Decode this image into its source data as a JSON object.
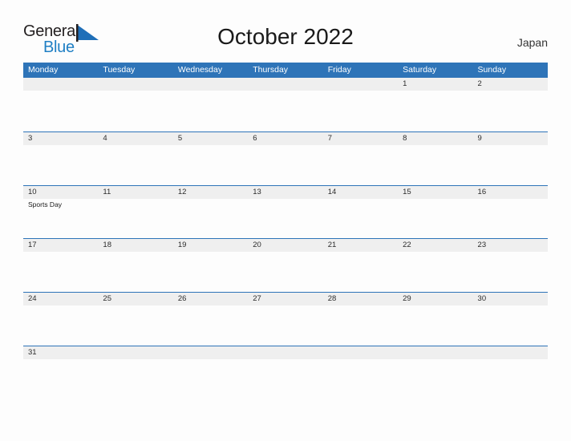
{
  "brand": {
    "word_one": "General",
    "word_two": "Blue",
    "flag_icon": "triangle-flag-icon",
    "color_dark": "#231f20",
    "color_blue": "#1f7fc4"
  },
  "header": {
    "title": "October 2022",
    "country": "Japan"
  },
  "theme": {
    "header_blue": "#2e74b8",
    "row_rule_blue": "#2e74b8",
    "day_band_gray": "#efefef",
    "page_background": "#fdfdfd",
    "text_dark": "#2b2b2b"
  },
  "calendar": {
    "weekdays": [
      "Monday",
      "Tuesday",
      "Wednesday",
      "Thursday",
      "Friday",
      "Saturday",
      "Sunday"
    ],
    "weeks": [
      {
        "days": [
          {
            "num": "",
            "event": ""
          },
          {
            "num": "",
            "event": ""
          },
          {
            "num": "",
            "event": ""
          },
          {
            "num": "",
            "event": ""
          },
          {
            "num": "",
            "event": ""
          },
          {
            "num": "1",
            "event": ""
          },
          {
            "num": "2",
            "event": ""
          }
        ]
      },
      {
        "days": [
          {
            "num": "3",
            "event": ""
          },
          {
            "num": "4",
            "event": ""
          },
          {
            "num": "5",
            "event": ""
          },
          {
            "num": "6",
            "event": ""
          },
          {
            "num": "7",
            "event": ""
          },
          {
            "num": "8",
            "event": ""
          },
          {
            "num": "9",
            "event": ""
          }
        ]
      },
      {
        "days": [
          {
            "num": "10",
            "event": "Sports Day"
          },
          {
            "num": "11",
            "event": ""
          },
          {
            "num": "12",
            "event": ""
          },
          {
            "num": "13",
            "event": ""
          },
          {
            "num": "14",
            "event": ""
          },
          {
            "num": "15",
            "event": ""
          },
          {
            "num": "16",
            "event": ""
          }
        ]
      },
      {
        "days": [
          {
            "num": "17",
            "event": ""
          },
          {
            "num": "18",
            "event": ""
          },
          {
            "num": "19",
            "event": ""
          },
          {
            "num": "20",
            "event": ""
          },
          {
            "num": "21",
            "event": ""
          },
          {
            "num": "22",
            "event": ""
          },
          {
            "num": "23",
            "event": ""
          }
        ]
      },
      {
        "days": [
          {
            "num": "24",
            "event": ""
          },
          {
            "num": "25",
            "event": ""
          },
          {
            "num": "26",
            "event": ""
          },
          {
            "num": "27",
            "event": ""
          },
          {
            "num": "28",
            "event": ""
          },
          {
            "num": "29",
            "event": ""
          },
          {
            "num": "30",
            "event": ""
          }
        ]
      },
      {
        "days": [
          {
            "num": "31",
            "event": ""
          },
          {
            "num": "",
            "event": ""
          },
          {
            "num": "",
            "event": ""
          },
          {
            "num": "",
            "event": ""
          },
          {
            "num": "",
            "event": ""
          },
          {
            "num": "",
            "event": ""
          },
          {
            "num": "",
            "event": ""
          }
        ]
      }
    ]
  }
}
